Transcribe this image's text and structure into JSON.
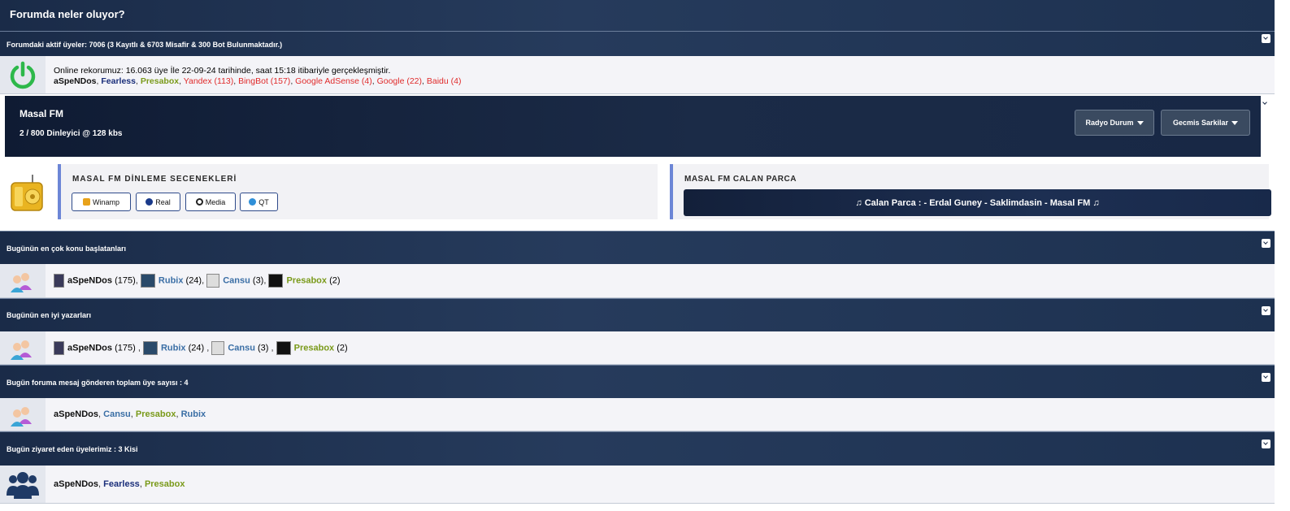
{
  "header": {
    "title": "Forumda neler oluyor?"
  },
  "active_users": {
    "heading": "Forumdaki aktif üyeler: 7006 (3 Kayıtlı & 6703 Misafir & 300 Bot Bulunmaktadır.)",
    "record_text": "Online rekorumuz: 16.063 üye İle 22-09-24 tarihinde, saat 15:18 itibariyle gerçekleşmiştir.",
    "members": [
      "aSpeNDos",
      "Fearless",
      "Presabox"
    ],
    "bots": [
      "Yandex (113)",
      "BingBot (157)",
      "Google AdSense (4)",
      "Google (22)",
      "Baidu (4)"
    ]
  },
  "radio": {
    "name": "Masal FM",
    "listeners": "2 / 800 Dinleyici @ 128 kbs",
    "status_btn": "Radyo Durum",
    "history_btn": "Gecmis Sarkilar"
  },
  "listen_options": {
    "title": "MASAL FM DİNLEME SECENEKLERİ",
    "buttons": [
      "Winamp",
      "Real",
      "Media",
      "QT"
    ]
  },
  "now_playing": {
    "title": "MASAL FM CALAN PARCA",
    "track": "♫ Calan Parca : - Erdal Guney - Saklimdasin - Masal FM ♫"
  },
  "top_starters": {
    "heading": "Bugünün en çok konu başlatanları",
    "users": [
      {
        "name": "aSpeNDos",
        "count": "(175)"
      },
      {
        "name": "Rubix",
        "count": "(24)"
      },
      {
        "name": "Cansu",
        "count": "(3)"
      },
      {
        "name": "Presabox",
        "count": "(2)"
      }
    ]
  },
  "top_posters": {
    "heading": "Bugünün en iyi yazarları",
    "users": [
      {
        "name": "aSpeNDos",
        "count": "(175)"
      },
      {
        "name": "Rubix",
        "count": "(24)"
      },
      {
        "name": "Cansu",
        "count": "(3)"
      },
      {
        "name": "Presabox",
        "count": "(2)"
      }
    ]
  },
  "posted_today": {
    "heading": "Bugün foruma mesaj gönderen toplam üye sayısı : 4",
    "users": [
      "aSpeNDos",
      "Cansu",
      "Presabox",
      "Rubix"
    ]
  },
  "visited_today": {
    "heading": "Bugün ziyaret eden üyelerimiz : 3 Kisi",
    "users": [
      "aSpeNDos",
      "Fearless",
      "Presabox"
    ]
  },
  "colors": {
    "header_bg": "#1a2b48",
    "link_blue": "#3a6ea5",
    "olive": "#7a9a1a",
    "bot_red": "#e02b2b"
  }
}
